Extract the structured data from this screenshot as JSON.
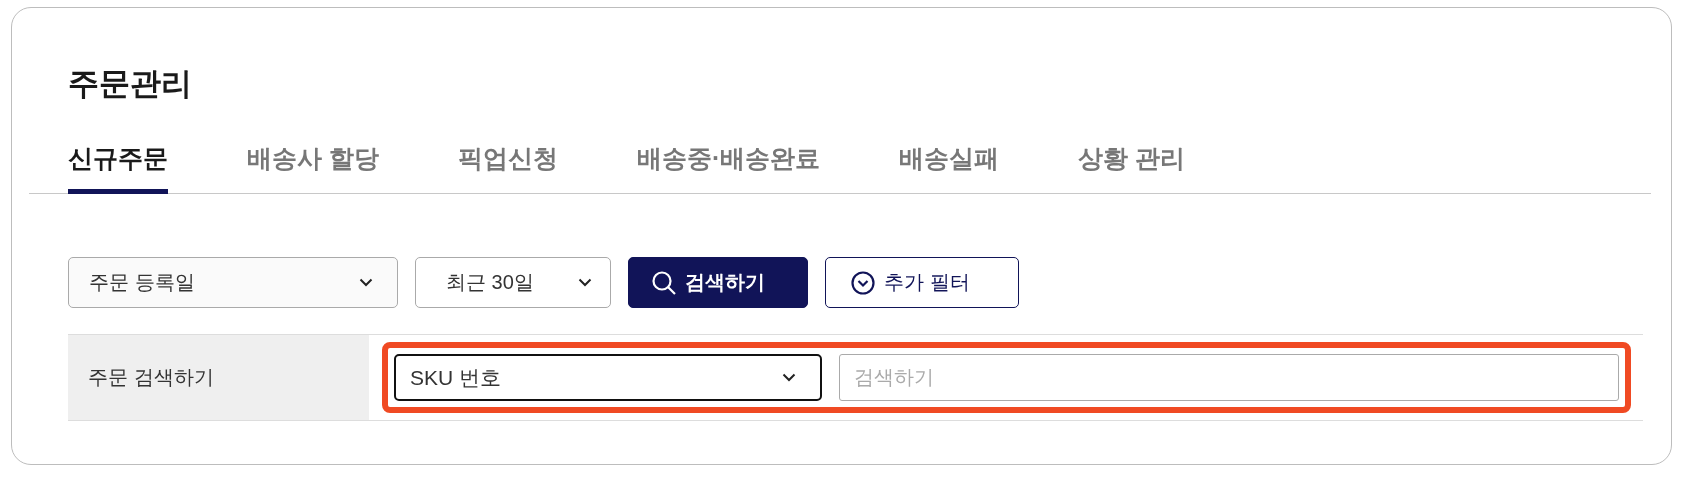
{
  "page": {
    "title": "주문관리"
  },
  "tabs": [
    {
      "label": "신규주문",
      "selected": true
    },
    {
      "label": "배송사 할당",
      "selected": false
    },
    {
      "label": "픽업신청",
      "selected": false
    },
    {
      "label": "배송중·배송완료",
      "selected": false
    },
    {
      "label": "배송실패",
      "selected": false
    },
    {
      "label": "상황 관리",
      "selected": false
    }
  ],
  "filters": {
    "date_type": "주문 등록일",
    "period": "최근 30일",
    "search_button": "검색하기",
    "more_filter_button": "추가 필터"
  },
  "search_row": {
    "label": "주문 검색하기",
    "field_type": "SKU 번호",
    "placeholder": "검색하기",
    "highlighted": true
  }
}
